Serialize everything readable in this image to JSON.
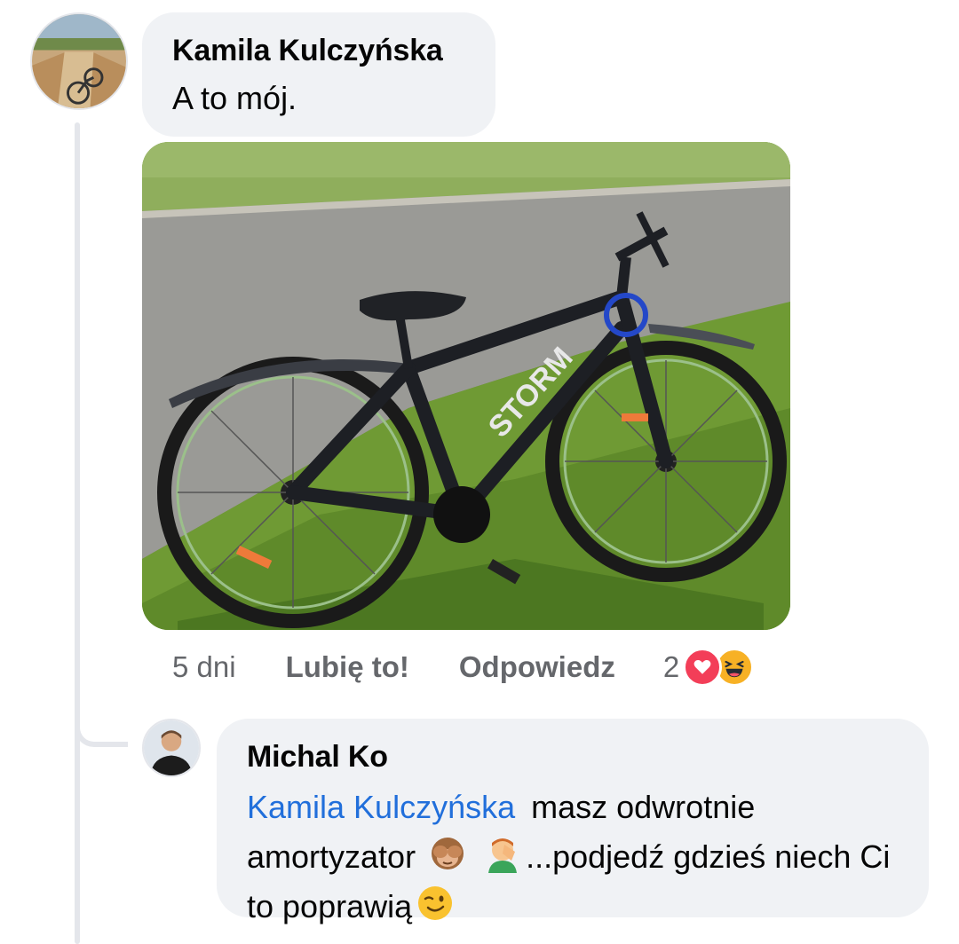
{
  "comment": {
    "author": "Kamila Kulczyńska",
    "text": "A to mój.",
    "time": "5 dni",
    "like_label": "Lubię to!",
    "reply_label": "Odpowiedz",
    "reaction_count": "2",
    "reactions": [
      "love-icon",
      "haha-icon"
    ],
    "photo": "bicycle-photo"
  },
  "reply": {
    "author": "Michal Ko",
    "mention": "Kamila Kulczyńska",
    "text_part1": "masz odwrotnie amortyzator",
    "text_part2": "...podjedź gdzieś niech Ci to poprawią",
    "emojis": [
      "see-no-evil-monkey-emoji",
      "man-facepalming-emoji",
      "winking-face-emoji"
    ]
  },
  "colors": {
    "bubble": "#f0f2f5",
    "mention": "#216fdb",
    "meta": "#65676b",
    "love": "#f33e58",
    "haha": "#f7b125"
  }
}
